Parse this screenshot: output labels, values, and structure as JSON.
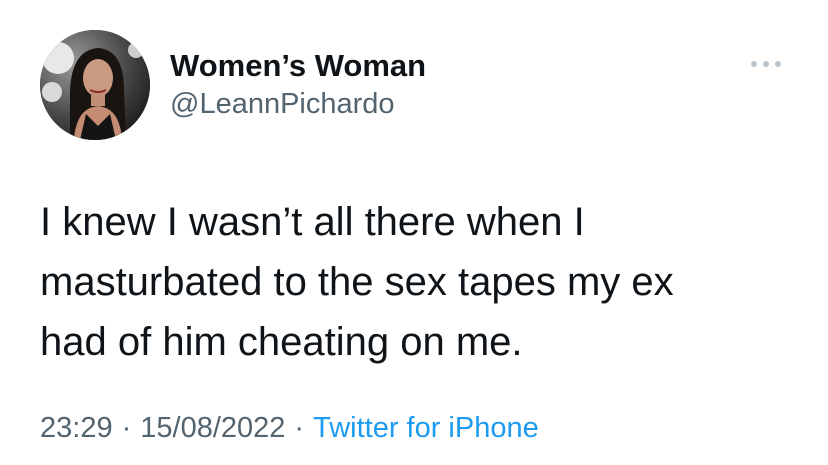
{
  "author": {
    "display_name": "Women’s Woman",
    "handle": "@LeannPichardo",
    "avatar_icon": "profile-photo"
  },
  "menu_icon": "more-options-icon",
  "tweet": {
    "text_lines": [
      "I knew I wasn’t all there when I",
      "masturbated to the sex tapes my ex",
      "had of him cheating on me."
    ]
  },
  "meta": {
    "time": "23:29",
    "separator": "·",
    "date": "15/08/2022",
    "source": "Twitter for iPhone"
  },
  "colors": {
    "text": "#0f1419",
    "secondary": "#536471",
    "link": "#1d9bf0",
    "menu_dots": "#b9c3cc"
  }
}
